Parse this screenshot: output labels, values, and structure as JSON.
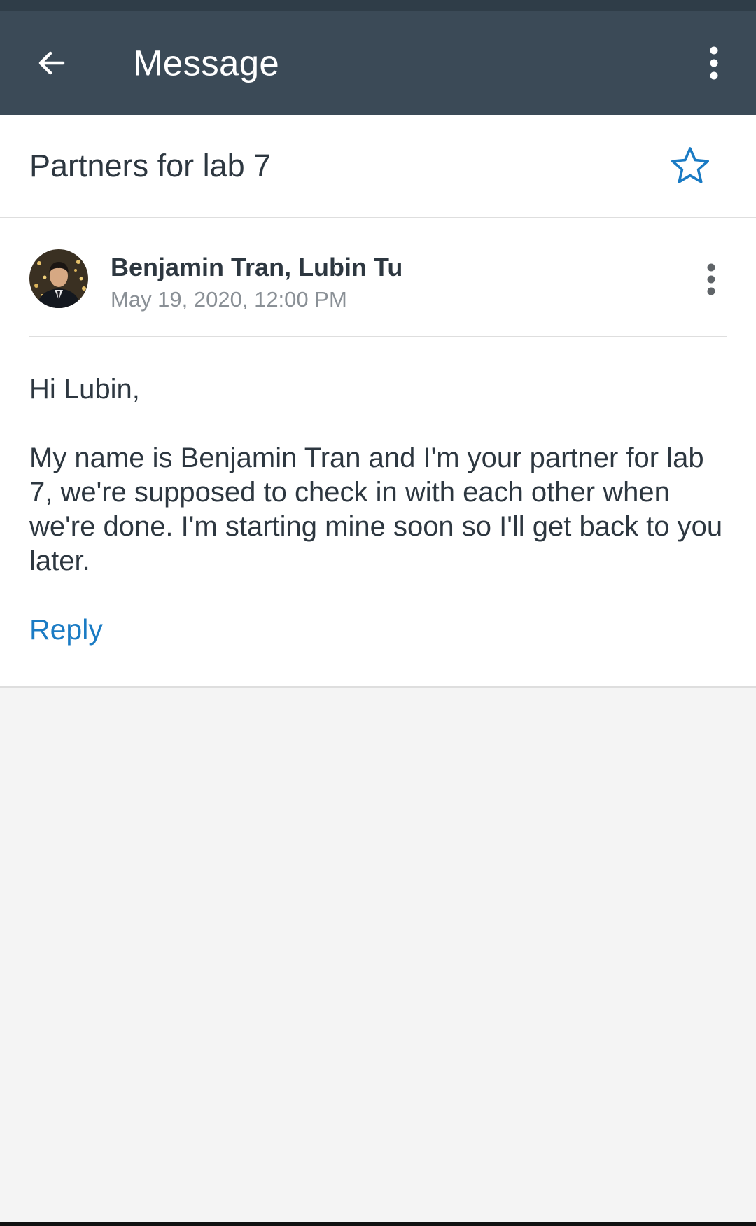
{
  "app_bar": {
    "title": "Message",
    "back_icon": "arrow-left-icon",
    "overflow_icon": "more-vertical-icon"
  },
  "message": {
    "subject": "Partners for lab 7",
    "star_icon": "star-outline-icon",
    "participants": "Benjamin Tran, Lubin Tu",
    "date": "May 19, 2020, 12:00 PM",
    "greeting": "Hi Lubin,",
    "body": "My name is Benjamin Tran and I'm your partner for lab 7, we're supposed to check in with each other when we're done. I'm starting mine soon so I'll get back to you later.",
    "reply_label": "Reply"
  },
  "colors": {
    "app_bar": "#3b4a57",
    "accent": "#1a7bc4",
    "text": "#2d3740",
    "muted": "#8a9096",
    "background": "#f4f4f4"
  }
}
